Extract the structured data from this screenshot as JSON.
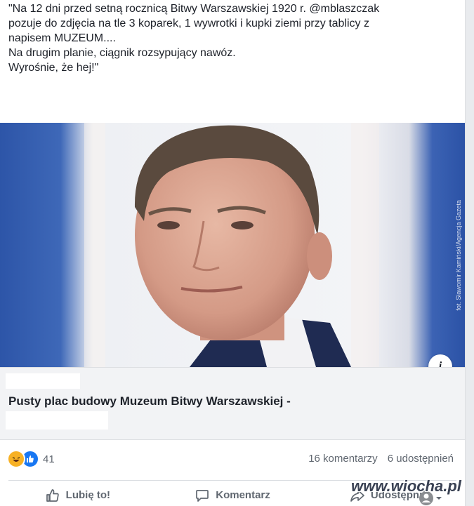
{
  "post": {
    "lines": [
      "\"Na 12 dni przed setną rocznicą Bitwy Warszawskiej 1920 r. @mblaszczak",
      "pozuje do zdjęcia na tle 3 koparek, 1 wywrotki i kupki ziemi przy tablicy z",
      "napisem MUZEUM....",
      "Na drugim planie, ciągnik rozsypujący nawóz.",
      "Wyrośnie, że hej!\""
    ]
  },
  "photo": {
    "credit": "fot. Sławomir Kamiński/Agencja Gazeta",
    "info_label": "i"
  },
  "link_preview": {
    "title": "Pusty plac budowy Muzeum Bitwy Warszawskiej -"
  },
  "engagement": {
    "reaction_count": "41",
    "comments": "16 komentarzy",
    "shares": "6 udostępnień"
  },
  "actions": {
    "like": "Lubię to!",
    "comment": "Komentarz",
    "share": "Udostępnij"
  },
  "watermark": {
    "text": "www.wiocha.pl"
  },
  "colors": {
    "like_blue": "#1877f2",
    "haha_yellow": "#f7b125",
    "text": "#1d2129",
    "muted": "#606770"
  }
}
